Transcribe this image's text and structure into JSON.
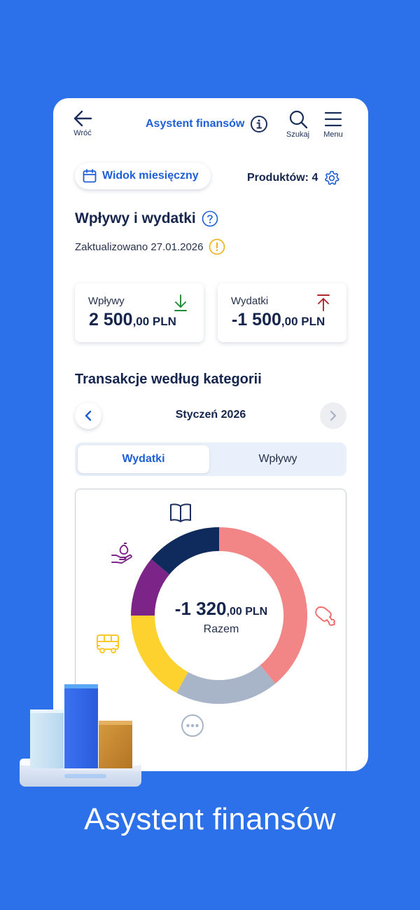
{
  "header": {
    "back_label": "Wróć",
    "title": "Asystent finansów",
    "search_label": "Szukaj",
    "menu_label": "Menu"
  },
  "toolbar": {
    "view_button": "Widok miesięczny",
    "products_label": "Produktów: 4"
  },
  "summary": {
    "title": "Wpływy i wydatki",
    "updated": "Zaktualizowano 27.01.2026",
    "income": {
      "label": "Wpływy",
      "amount_main": "2 500",
      "amount_decimals": ",00 PLN"
    },
    "expenses": {
      "label": "Wydatki",
      "amount_main": "-1 500",
      "amount_decimals": ",00 PLN"
    }
  },
  "categories": {
    "title": "Transakcje według kategorii",
    "month": "Styczeń 2026",
    "tabs": [
      "Wydatki",
      "Wpływy"
    ],
    "active_tab": "Wydatki"
  },
  "donut": {
    "total_main": "-1 320",
    "total_decimals": ",00 PLN",
    "total_label": "Razem",
    "segments": [
      {
        "category": "food",
        "icon": "chicken-leg-icon",
        "fraction": 0.39,
        "color": "#f28585"
      },
      {
        "category": "other",
        "icon": "more-icon",
        "fraction": 0.19,
        "color": "#a8b5c8"
      },
      {
        "category": "transport",
        "icon": "bus-icon",
        "fraction": 0.17,
        "color": "#fdd22e"
      },
      {
        "category": "finance",
        "icon": "money-bag-hand-icon",
        "fraction": 0.11,
        "color": "#7c2487"
      },
      {
        "category": "education",
        "icon": "book-icon",
        "fraction": 0.14,
        "color": "#0f2a5c"
      }
    ]
  },
  "footer": {
    "caption": "Asystent finansów"
  },
  "colors": {
    "background": "#2c70ea",
    "accent": "#1e5fd6",
    "text_dark": "#15254d",
    "income": "#1f8a36",
    "expense": "#b3262b"
  }
}
